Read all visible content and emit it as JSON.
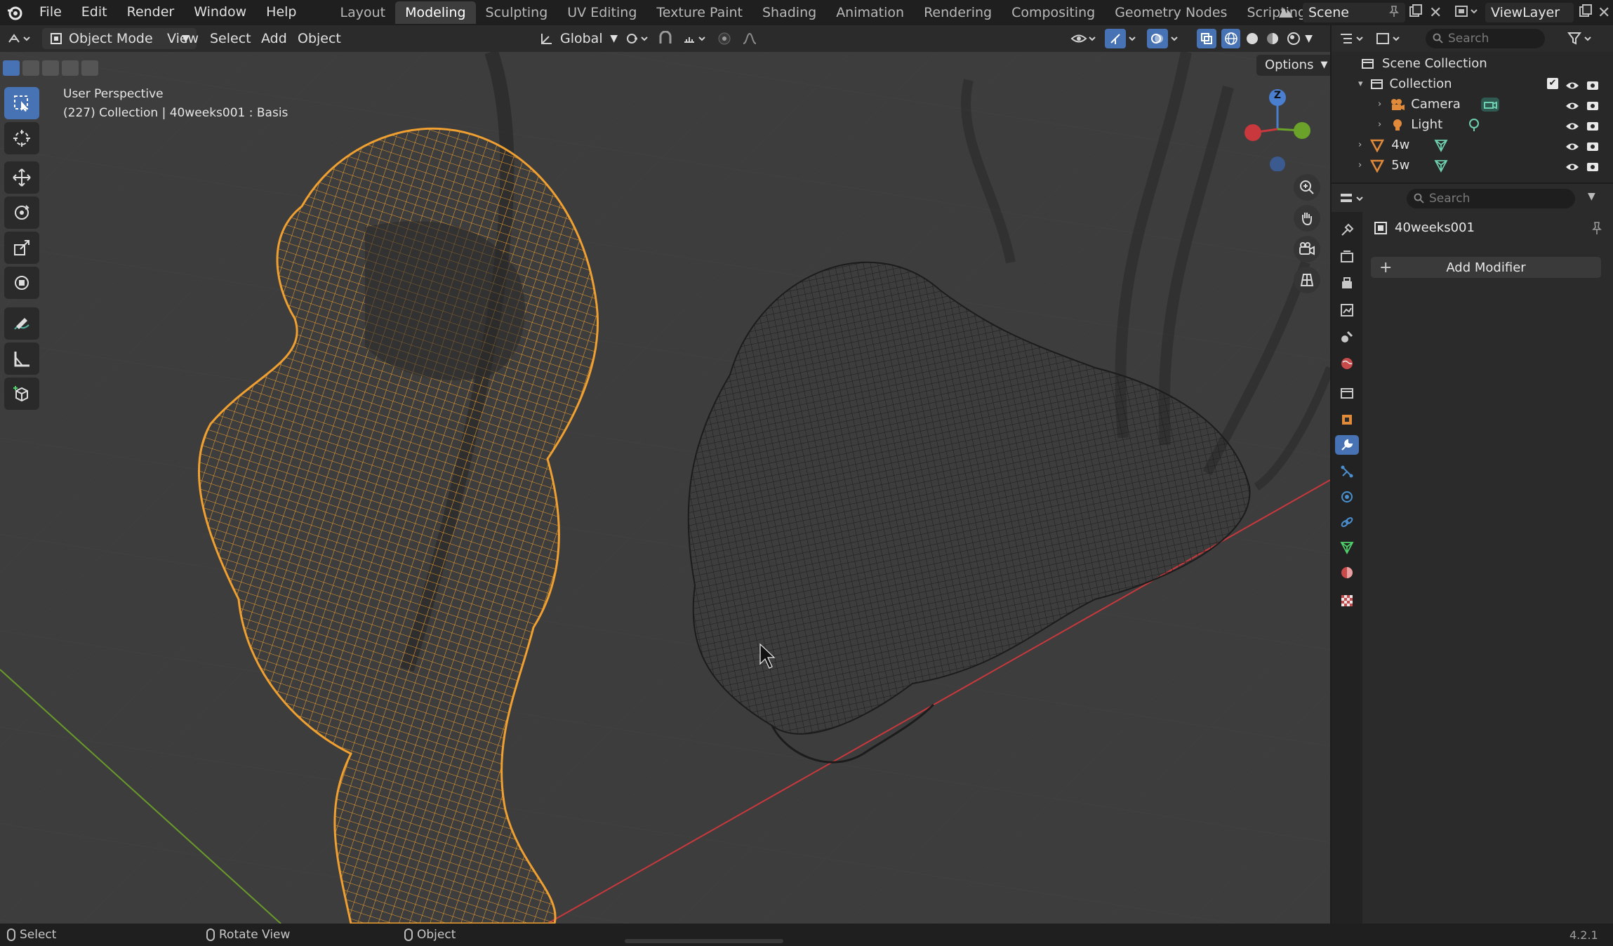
{
  "topbar": {
    "menus": [
      "File",
      "Edit",
      "Render",
      "Window",
      "Help"
    ],
    "workspaces": [
      "Layout",
      "Modeling",
      "Sculpting",
      "UV Editing",
      "Texture Paint",
      "Shading",
      "Animation",
      "Rendering",
      "Compositing",
      "Geometry Nodes",
      "Scripting"
    ],
    "active_workspace": "Modeling",
    "scene_name": "Scene",
    "view_layer": "ViewLayer"
  },
  "viewport_header": {
    "mode": "Object Mode",
    "menus": [
      "View",
      "Select",
      "Add",
      "Object"
    ],
    "transform_orientation": "Global",
    "options_label": "Options"
  },
  "viewport": {
    "perspective_label": "User Perspective",
    "object_info": "(227) Collection | 40weeks001 : Basis",
    "gizmo_axis_label": "Z",
    "colors": {
      "selected_wire": "#f0a030",
      "unselected_wire": "#1e1e1e",
      "x_axis": "#c8383c",
      "y_axis": "#6a9a2a"
    }
  },
  "outliner": {
    "search_placeholder": "Search",
    "root": "Scene Collection",
    "items": [
      {
        "label": "Collection",
        "type": "collection"
      },
      {
        "label": "Camera",
        "type": "camera"
      },
      {
        "label": "Light",
        "type": "light"
      },
      {
        "label": "4w",
        "type": "mesh"
      },
      {
        "label": "5w",
        "type": "mesh"
      }
    ]
  },
  "properties": {
    "search_placeholder": "Search",
    "object_name": "40weeks001",
    "add_modifier_label": "Add Modifier",
    "tabs": [
      "tool-icon",
      "render-icon",
      "output-icon",
      "view-layer-icon",
      "scene-icon",
      "world-icon",
      "collection-icon",
      "object-icon",
      "modifier-icon",
      "particles-icon",
      "physics-icon",
      "constraints-icon",
      "data-icon",
      "material-icon",
      "texture-icon"
    ],
    "active_tab": "modifier-icon"
  },
  "statusbar": {
    "select": "Select",
    "rotate": "Rotate View",
    "object": "Object",
    "version": "4.2.1"
  }
}
